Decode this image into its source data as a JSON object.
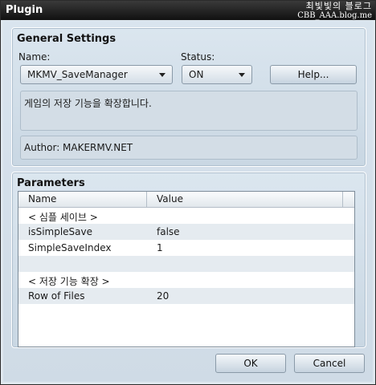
{
  "window": {
    "title": "Plugin",
    "watermark": [
      "최빛빛의 블로그",
      "CBB_AAA.blog.me"
    ]
  },
  "general": {
    "title": "General Settings",
    "name_label": "Name:",
    "name_value": "MKMV_SaveManager",
    "status_label": "Status:",
    "status_value": "ON",
    "help_label": "Help...",
    "description": "게임의 저장 기능을 확장합니다.",
    "author": "Author: MAKERMV.NET"
  },
  "parameters": {
    "title": "Parameters",
    "columns": [
      "Name",
      "Value"
    ],
    "rows": [
      {
        "name": "< 심플 세이브 >",
        "value": ""
      },
      {
        "name": "isSimpleSave",
        "value": "false"
      },
      {
        "name": "SimpleSaveIndex",
        "value": "1"
      },
      {
        "name": "",
        "value": ""
      },
      {
        "name": "< 저장 기능 확장 >",
        "value": ""
      },
      {
        "name": "Row of Files",
        "value": "20"
      },
      {
        "name": "",
        "value": ""
      }
    ]
  },
  "footer": {
    "ok_label": "OK",
    "cancel_label": "Cancel"
  }
}
